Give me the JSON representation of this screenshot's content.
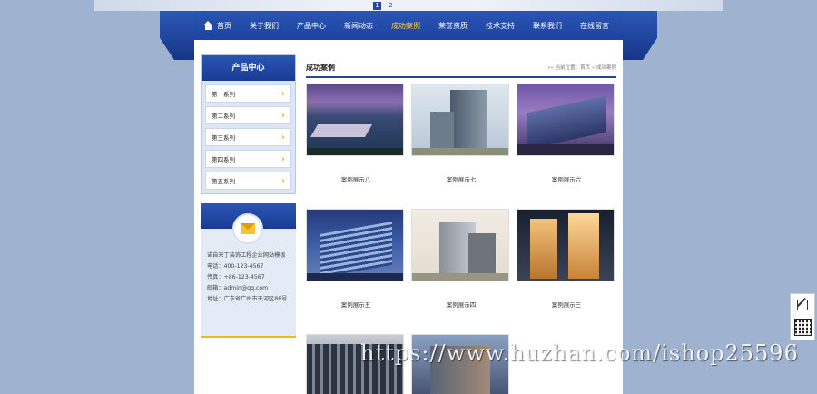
{
  "banner": {
    "pages": [
      "1",
      "2"
    ]
  },
  "nav": {
    "items": [
      "首页",
      "关于我们",
      "产品中心",
      "新闻动态",
      "成功案例",
      "荣誉资质",
      "技术支持",
      "联系我们",
      "在线留言"
    ],
    "active_index": 4
  },
  "sidebar": {
    "title": "产品中心",
    "items": [
      "第一系列",
      "第二系列",
      "第三系列",
      "第四系列",
      "第五系列"
    ]
  },
  "contact": {
    "lines": [
      "诺自来丁装饰工程企业网站模板",
      "电话：400-123-4567",
      "传真：+86-123-4567",
      "邮箱：admin@qq.com",
      "地址：广东省广州市天河区88号"
    ]
  },
  "content": {
    "title": "成功案例",
    "breadcrumb": "»» 当前位置：首页 » 成功案例",
    "cases": [
      "案例展示八",
      "案例展示七",
      "案例展示六",
      "案例展示五",
      "案例展示四",
      "案例展示三",
      "",
      ""
    ]
  },
  "watermark": "https://www.huzhan.com/ishop25596",
  "colors": {
    "nav_blue": "#1d43a0",
    "accent_yellow": "#f2b51c",
    "background": "#9fb2cf"
  },
  "icons": [
    "home-icon",
    "chevron-right-icon",
    "mail-icon",
    "edit-icon",
    "qr-code-icon"
  ]
}
